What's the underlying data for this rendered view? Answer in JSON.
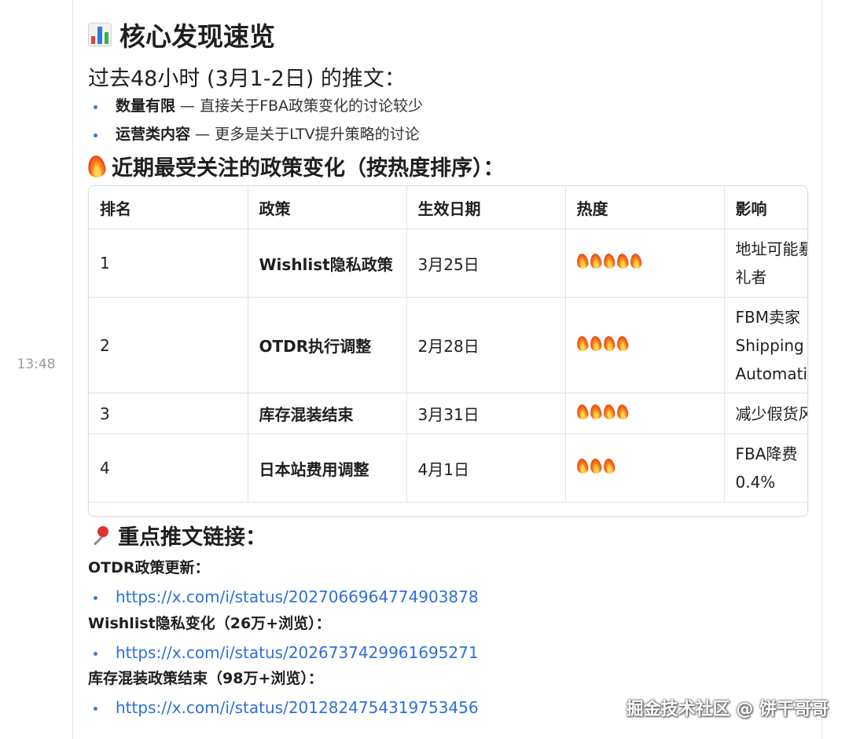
{
  "timestamp": "13:48",
  "title": "核心发现速览",
  "subtitle": "过去48小时 (3月1-2日) 的推文：",
  "bullets": [
    {
      "bold": "数量有限",
      "rest": " — 直接关于FBA政策变化的讨论较少"
    },
    {
      "bold": "运营类内容",
      "rest": " — 更多是关于LTV提升策略的讨论"
    }
  ],
  "hot_section_title": "近期最受关注的政策变化（按热度排序）：",
  "table": {
    "headers": [
      "排名",
      "政策",
      "生效日期",
      "热度",
      "影响"
    ],
    "rows": [
      {
        "rank": "1",
        "policy": "Wishlist隐私政策",
        "date": "3月25日",
        "heat": 5,
        "impact": "地址可能暴\n礼者"
      },
      {
        "rank": "2",
        "policy": "OTDR执行调整",
        "date": "2月28日",
        "heat": 4,
        "impact": "FBM卖家\nShipping\nAutomati"
      },
      {
        "rank": "3",
        "policy": "库存混装结束",
        "date": "3月31日",
        "heat": 4,
        "impact": "减少假货风"
      },
      {
        "rank": "4",
        "policy": "日本站费用调整",
        "date": "4月1日",
        "heat": 3,
        "impact": "FBA降费\n0.4%"
      }
    ]
  },
  "links_title": "重点推文链接：",
  "links": [
    {
      "label": "OTDR政策更新：",
      "url": "https://x.com/i/status/2027066964774903878"
    },
    {
      "label": "Wishlist隐私变化（26万+浏览）：",
      "url": "https://x.com/i/status/2026737429961695271"
    },
    {
      "label": "库存混装政策结束（98万+浏览）：",
      "url": "https://x.com/i/status/2012824754319753456"
    }
  ],
  "watermark": "掘金技术社区 @ 饼干哥哥",
  "colors": {
    "link": "#2e6fd8",
    "bullet_dot": "#3a7bd5",
    "timestamp": "#9a9a9a"
  },
  "icons": {
    "title": "bar-chart-emoji-icon",
    "hot": "fire-emoji-icon",
    "links": "pushpin-emoji-icon"
  }
}
